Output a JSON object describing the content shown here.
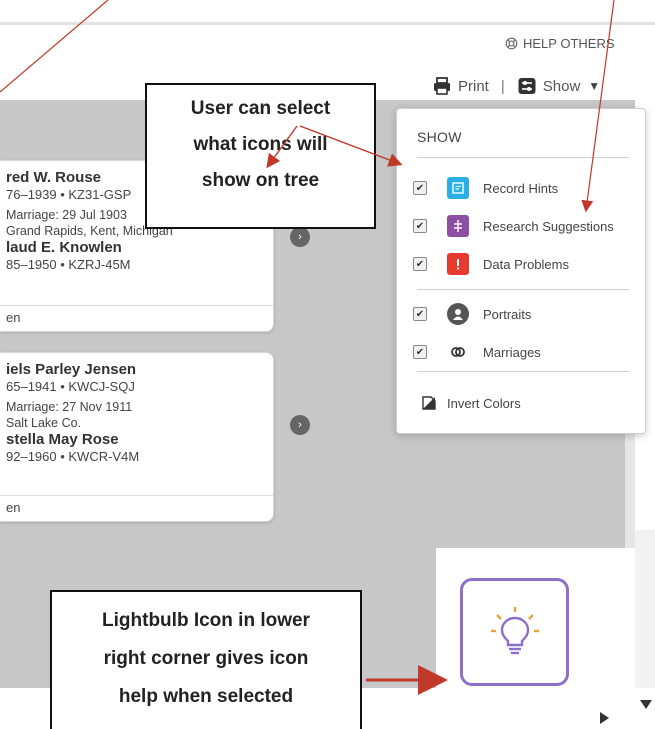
{
  "header": {
    "help_label": "HELP OTHERS",
    "print_label": "Print",
    "separator": "|",
    "show_label": "Show"
  },
  "tree": {
    "cards": [
      {
        "husband_name": "red W. Rouse",
        "husband_meta": "76–1939 • KZ31-GSP",
        "marriage": "Marriage: 29 Jul 1903",
        "place": "Grand Rapids, Kent, Michigan",
        "wife_name": "laud E. Knowlen",
        "wife_meta": "85–1950 • KZRJ-45M",
        "footer": "en"
      },
      {
        "husband_name": "iels Parley Jensen",
        "husband_meta": "65–1941 • KWCJ-SQJ",
        "marriage": "Marriage: 27 Nov 1911",
        "place": "Salt Lake Co.",
        "wife_name": "stella May Rose",
        "wife_meta": "92–1960 • KWCR-V4M",
        "footer": "en"
      }
    ]
  },
  "show_panel": {
    "title": "SHOW",
    "options": [
      {
        "label": "Record Hints",
        "checked": true,
        "icon": "record-hint-icon",
        "color": "#29aee6"
      },
      {
        "label": "Research Suggestions",
        "checked": true,
        "icon": "research-suggestion-icon",
        "color": "#8c4fa3"
      },
      {
        "label": "Data Problems",
        "checked": true,
        "icon": "data-problem-icon",
        "color": "#e63b2e"
      },
      {
        "label": "Portraits",
        "checked": true,
        "icon": "portrait-icon",
        "color": "#555555"
      },
      {
        "label": "Marriages",
        "checked": true,
        "icon": "marriage-rings-icon",
        "color": "#333333"
      }
    ],
    "invert_label": "Invert Colors"
  },
  "annotations": {
    "callout_top": [
      "User can select",
      "what icons will",
      "show on tree"
    ],
    "callout_bottom": [
      "Lightbulb Icon in lower",
      "right corner gives icon",
      "help when selected"
    ],
    "arrow_color": "#c0392b"
  },
  "colors": {
    "canvas_bg": "#c7c7c7",
    "bulb_border": "#8e6fc9"
  }
}
